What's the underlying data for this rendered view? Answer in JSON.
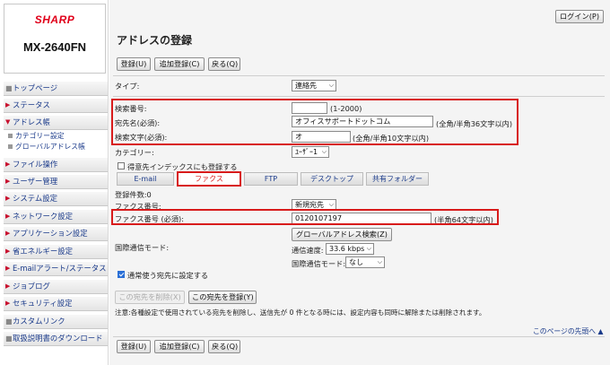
{
  "sidebar": {
    "brand": "SHARP",
    "model": "MX-2640FN",
    "items": [
      {
        "label": "トップページ"
      },
      {
        "label": "ステータス"
      },
      {
        "label": "アドレス帳"
      },
      {
        "label": "カテゴリー設定"
      },
      {
        "label": "グローバルアドレス帳"
      },
      {
        "label": "ファイル操作"
      },
      {
        "label": "ユーザー管理"
      },
      {
        "label": "システム設定"
      },
      {
        "label": "ネットワーク設定"
      },
      {
        "label": "アプリケーション設定"
      },
      {
        "label": "省エネルギー設定"
      },
      {
        "label": "E-mailアラート/ステータス"
      },
      {
        "label": "ジョブログ"
      },
      {
        "label": "セキュリティ設定"
      },
      {
        "label": "カスタムリンク"
      },
      {
        "label": "取扱説明書のダウンロード"
      }
    ]
  },
  "header": {
    "login_label": "ログイン(P)",
    "title": "アドレスの登録"
  },
  "toolbar": {
    "register": "登録(U)",
    "add_register": "追加登録(C)",
    "back": "戻る(Q)"
  },
  "form": {
    "type_label": "タイプ:",
    "type_value": "連絡先",
    "search_no_label": "検索番号:",
    "search_no_value": "",
    "search_no_hint": "(1-2000)",
    "dest_name_label": "宛先名(必須):",
    "dest_name_value": "オフィスサポートドットコム",
    "dest_name_hint": "(全角/半角36文字以内)",
    "search_char_label": "検索文字(必須):",
    "search_char_value": "オ",
    "search_char_hint": "(全角/半角10文字以内)",
    "category_label": "カテゴリー:",
    "category_value": "ﾕｰｻﾞｰ1",
    "frequent_index_label": "得意先インデックスにも登録する",
    "tabs": [
      {
        "label": "E-mail"
      },
      {
        "label": "ファクス"
      },
      {
        "label": "FTP"
      },
      {
        "label": "デスクトップ"
      },
      {
        "label": "共有フォルダー"
      }
    ],
    "reg_count_label": "登録件数:0",
    "fax_no_label": "ファクス番号:",
    "fax_no_select": "新規宛先",
    "fax_number_label": "ファクス番号 (必須):",
    "fax_number_value": "0120107197",
    "fax_number_hint": "(半角64文字以内)",
    "global_search_button": "グローバルアドレス検索(Z)",
    "intl_mode_label": "国際通信モード:",
    "speed_label": "通信速度:",
    "speed_value": "33.6 kbps",
    "intl_mode_sub_label": "国際通信モード:",
    "intl_mode_value": "なし",
    "default_dest_label": "通常使う宛先に設定する",
    "delete_dest_button": "この宛先を削除(X)",
    "register_dest_button": "この宛先を登録(Y)",
    "note": "注意:各種設定で使用されている宛先を削除し、送信先が 0 件となる時には、設定内容も同時に解除または削除されます。",
    "page_top_link": "このページの先頭へ"
  },
  "colors": {
    "highlight": "#d81b1b",
    "link": "#1a3a8a",
    "brand": "#e0001a"
  }
}
